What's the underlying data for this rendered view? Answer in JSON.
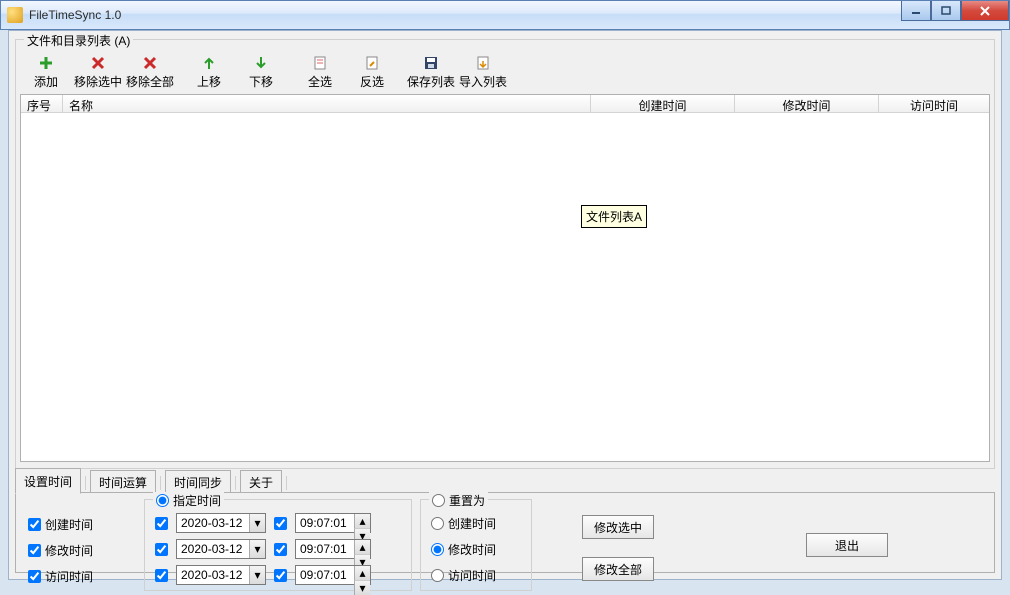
{
  "window": {
    "title": "FileTimeSync 1.0"
  },
  "group_list_legend": "文件和目录列表 (A)",
  "toolbar": [
    {
      "id": "add",
      "label": "添加"
    },
    {
      "id": "remove-selected",
      "label": "移除选中"
    },
    {
      "id": "remove-all",
      "label": "移除全部"
    },
    {
      "id": "move-up",
      "label": "上移"
    },
    {
      "id": "move-down",
      "label": "下移"
    },
    {
      "id": "select-all",
      "label": "全选"
    },
    {
      "id": "invert",
      "label": "反选"
    },
    {
      "id": "save-list",
      "label": "保存列表"
    },
    {
      "id": "import-list",
      "label": "导入列表"
    }
  ],
  "columns": {
    "index": "序号",
    "name": "名称",
    "ctime": "创建时间",
    "mtime": "修改时间",
    "atime": "访问时间"
  },
  "tooltip": "文件列表A",
  "tabs": {
    "set_time": "设置时间",
    "time_calc": "时间运算",
    "time_sync": "时间同步",
    "about": "关于"
  },
  "panel": {
    "chk_ctime": "创建时间",
    "chk_mtime": "修改时间",
    "chk_atime": "访问时间",
    "fs_specified": "指定时间",
    "date": "2020-03-12",
    "time": "09:07:01",
    "fs_reset": "重置为",
    "radio_ctime": "创建时间",
    "radio_mtime": "修改时间",
    "radio_atime": "访问时间",
    "btn_mod_sel": "修改选中",
    "btn_mod_all": "修改全部",
    "btn_exit": "退出"
  }
}
